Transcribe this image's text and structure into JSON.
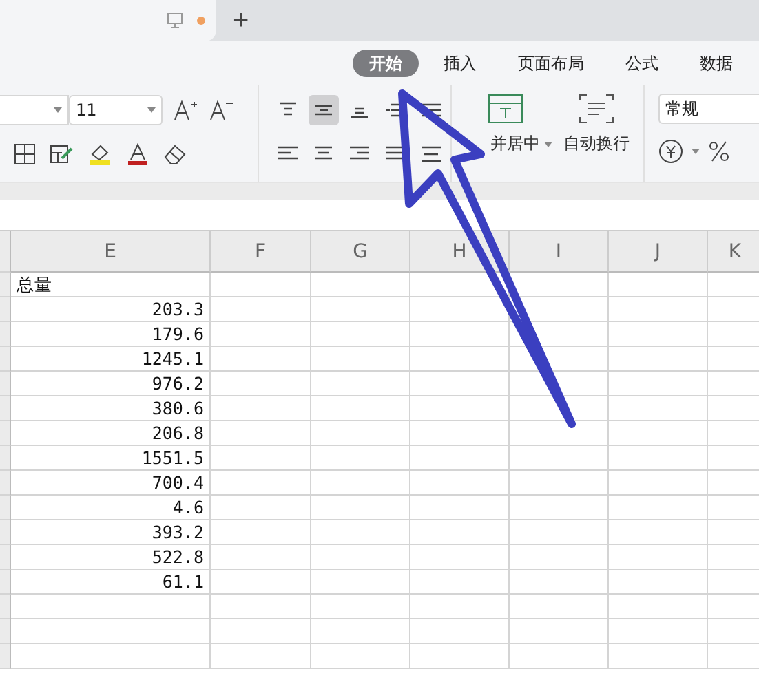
{
  "new_tab": "+",
  "menu_tabs": [
    {
      "label": "开始",
      "selected": true
    },
    {
      "label": "插入",
      "selected": false
    },
    {
      "label": "页面布局",
      "selected": false
    },
    {
      "label": "公式",
      "selected": false
    },
    {
      "label": "数据",
      "selected": false
    }
  ],
  "toolbar": {
    "font_size": "11",
    "merge_label": "并居中",
    "wrap_label": "自动换行",
    "number_format": "常规",
    "center_align_selected": true
  },
  "sheet": {
    "columns": [
      "E",
      "F",
      "G",
      "H",
      "I",
      "J",
      "K"
    ],
    "rows": [
      "总量",
      "203.3",
      "179.6",
      "1245.1",
      "976.2",
      "380.6",
      "206.8",
      "1551.5",
      "700.4",
      "4.6",
      "393.2",
      "522.8",
      "61.1",
      "",
      "",
      ""
    ]
  }
}
